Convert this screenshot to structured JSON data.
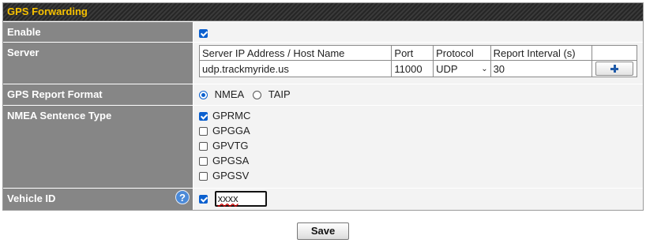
{
  "panel": {
    "title": "GPS Forwarding"
  },
  "enable": {
    "label": "Enable",
    "checked": true
  },
  "server": {
    "label": "Server",
    "columns": [
      "Server IP Address / Host Name",
      "Port",
      "Protocol",
      "Report Interval (s)"
    ],
    "row": {
      "host": "udp.trackmyride.us",
      "port": "11000",
      "protocol": "UDP",
      "interval": "30"
    },
    "add_icon": "plus-icon"
  },
  "report_format": {
    "label": "GPS Report Format",
    "options": [
      {
        "label": "NMEA",
        "selected": true
      },
      {
        "label": "TAIP",
        "selected": false
      }
    ]
  },
  "nmea": {
    "label": "NMEA Sentence Type",
    "options": [
      {
        "label": "GPRMC",
        "checked": true
      },
      {
        "label": "GPGGA",
        "checked": false
      },
      {
        "label": "GPVTG",
        "checked": false
      },
      {
        "label": "GPGSA",
        "checked": false
      },
      {
        "label": "GPGSV",
        "checked": false
      }
    ]
  },
  "vehicle": {
    "label": "Vehicle ID",
    "help": "?",
    "checked": true,
    "value": "xxxx"
  },
  "actions": {
    "save_label": "Save"
  },
  "colors": {
    "title_text": "#f7c100",
    "label_bg": "#868686",
    "value_bg": "#f3f3f3",
    "accent": "#0b60cf"
  }
}
